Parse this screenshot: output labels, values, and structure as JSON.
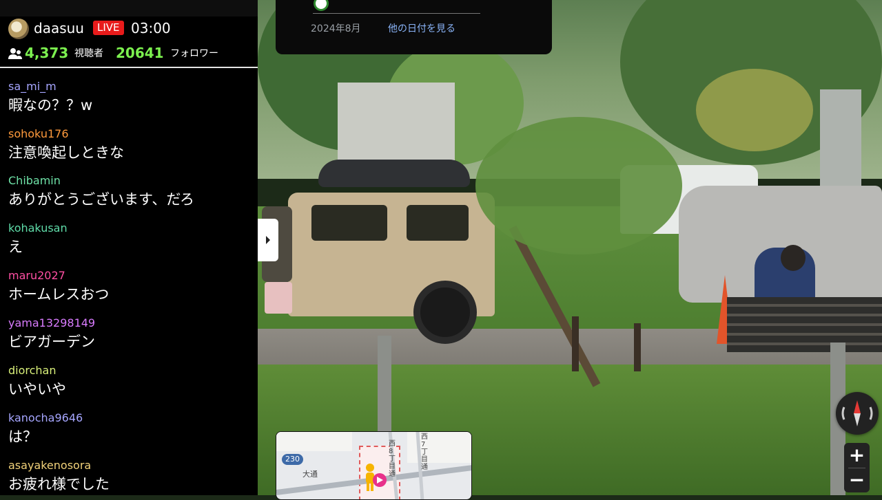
{
  "stream": {
    "username": "daasuu",
    "live_label": "LIVE",
    "duration": "03:00",
    "viewer_count": "4,373",
    "viewer_label": "視聴者",
    "follower_count": "20641",
    "follower_label": "フォロワー"
  },
  "chat": [
    {
      "user": "sa_mi_m",
      "text": "暇なの？？w",
      "color": "#a6a6ff"
    },
    {
      "user": "sohoku176",
      "text": "注意喚起しときな",
      "color": "#ff9a3c"
    },
    {
      "user": "Chibamin",
      "text": "ありがとうございます、だろ",
      "color": "#6fe3a8"
    },
    {
      "user": "kohakusan",
      "text": "え",
      "color": "#5fdca9"
    },
    {
      "user": "maru2027",
      "text": "ホームレスおつ",
      "color": "#ff4fa3"
    },
    {
      "user": "yama13298149",
      "text": "ビアガーデン",
      "color": "#d97cff"
    },
    {
      "user": "diorchan",
      "text": "いやいや",
      "color": "#d9f07a"
    },
    {
      "user": "kanocha9646",
      "text": "は？",
      "color": "#a6a6ff"
    },
    {
      "user": "asayakenosora",
      "text": "お疲れ様でした",
      "color": "#f2d27a"
    }
  ],
  "date_popup": {
    "date": "2024年8月",
    "other_dates_link": "他の日付を見る"
  },
  "minimap": {
    "route_number": "230",
    "street_label": "大通",
    "label_west": "西8丁目通",
    "label_east": "西7丁目通"
  },
  "controls": {
    "zoom_in": "+",
    "zoom_out": "−"
  }
}
